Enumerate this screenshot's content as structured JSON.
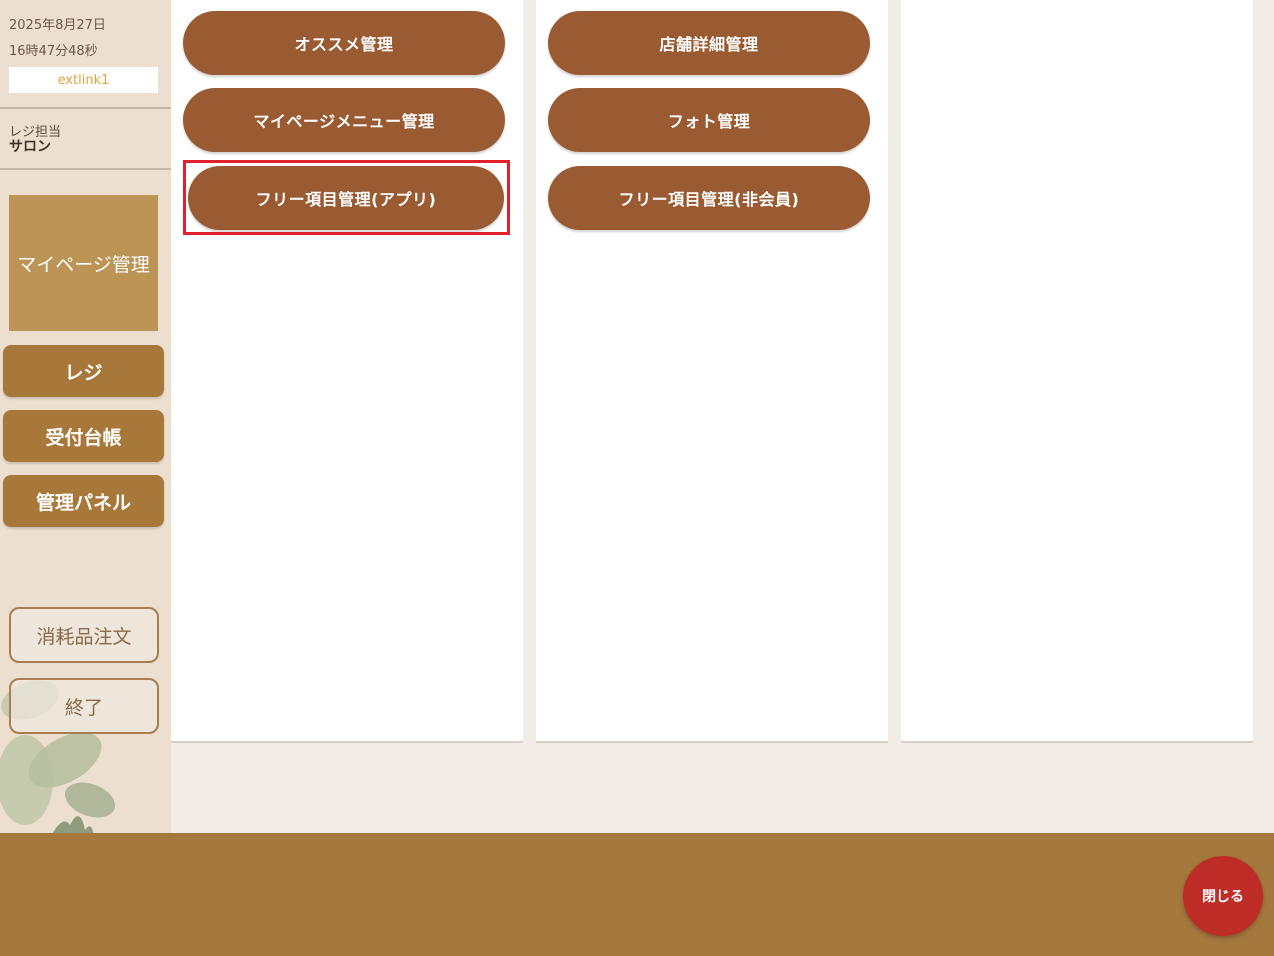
{
  "sidebar": {
    "date": "2025年8月27日",
    "time": "16時47分48秒",
    "link_label": "extlink1",
    "staff_label": "レジ担当",
    "staff_name": "サロン",
    "current_section": "マイページ管理",
    "nav": [
      {
        "label": "レジ"
      },
      {
        "label": "受付台帳"
      },
      {
        "label": "管理パネル"
      }
    ],
    "actions": [
      {
        "label": "消耗品注文"
      },
      {
        "label": "終了"
      }
    ]
  },
  "panels": [
    {
      "buttons": [
        {
          "label": "オススメ管理"
        },
        {
          "label": "マイページメニュー管理"
        },
        {
          "label": "フリー項目管理(アプリ)",
          "highlighted": true
        }
      ]
    },
    {
      "buttons": [
        {
          "label": "店舗詳細管理"
        },
        {
          "label": "フォト管理"
        },
        {
          "label": "フリー項目管理(非会員)"
        }
      ]
    },
    {
      "buttons": []
    }
  ],
  "footer": {
    "close_label": "閉じる"
  },
  "colors": {
    "pill": "#9a5b33",
    "sidebar_nav": "#a8783a",
    "footer": "#a5783d",
    "close": "#bd2c26",
    "highlight": "#e0202a"
  }
}
